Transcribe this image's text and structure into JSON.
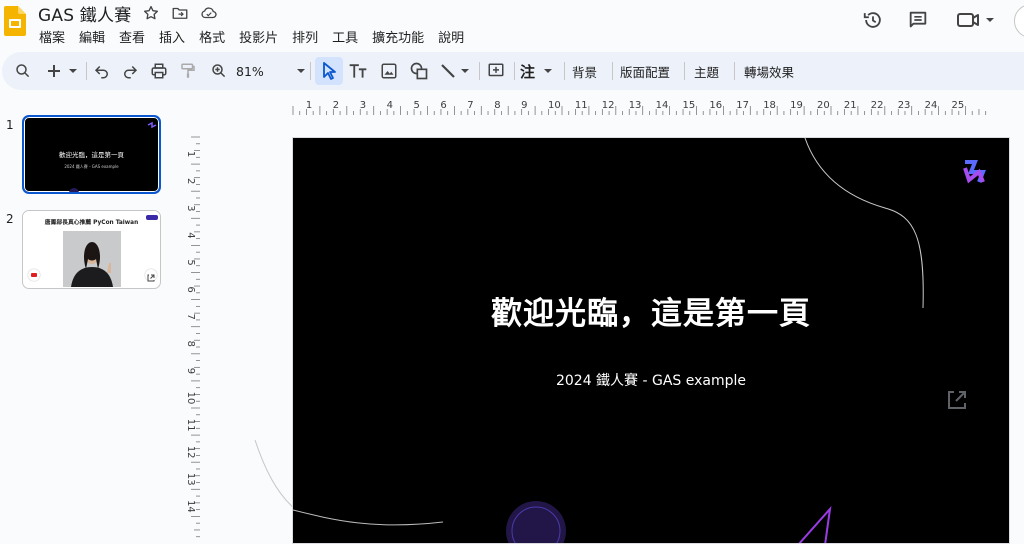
{
  "header": {
    "title": "GAS 鐵人賽",
    "menu": [
      "檔案",
      "編輯",
      "查看",
      "插入",
      "格式",
      "投影片",
      "排列",
      "工具",
      "擴充功能",
      "說明"
    ]
  },
  "toolbar": {
    "zoom": "81%",
    "comment_label": "注",
    "background_label": "背景",
    "layout_label": "版面配置",
    "theme_label": "主題",
    "transition_label": "轉場效果"
  },
  "filmstrip": {
    "slides": [
      {
        "number": "1",
        "title": "歡迎光臨，這是第一頁",
        "subtitle": "2024 鐵人賽 - GAS example"
      },
      {
        "number": "2",
        "title": "唐鳳部長真心推薦 PyCon Taiwan"
      }
    ]
  },
  "rulers": {
    "horizontal": [
      "1",
      "2",
      "3",
      "4",
      "5",
      "6",
      "7",
      "8",
      "9",
      "10",
      "11",
      "12",
      "13",
      "14",
      "15",
      "16",
      "17",
      "18",
      "19",
      "20",
      "21",
      "22",
      "23",
      "24",
      "25"
    ],
    "vertical": [
      "1",
      "2",
      "3",
      "4",
      "5",
      "6",
      "7",
      "8",
      "9",
      "10",
      "11",
      "12",
      "13",
      "14"
    ]
  },
  "slide": {
    "title": "歡迎光臨，這是第一頁",
    "subtitle": "2024 鐵人賽 - GAS example"
  },
  "colors": {
    "accent": "#0b57d0",
    "toolbar_bg": "#edf2fa",
    "slides_logo": "#f4b400",
    "slide_bg": "#000000"
  },
  "icons": {
    "title_row": [
      "star-icon",
      "move-to-folder-icon",
      "cloud-saved-icon"
    ],
    "header_right": [
      "version-history-icon",
      "comments-icon",
      "meet-camera-icon"
    ]
  }
}
